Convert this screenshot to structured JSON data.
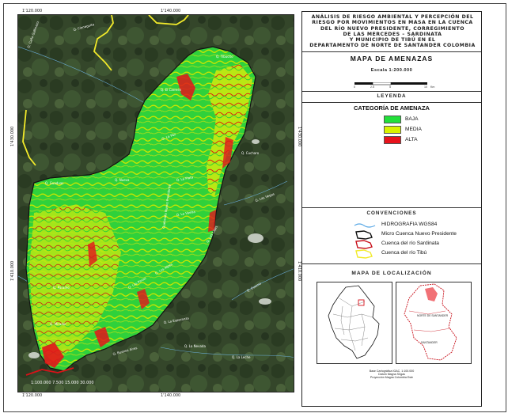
{
  "title_lines": [
    "ANÁLISIS DE RIESGO AMBIENTAL Y PERCEPCIÓN DEL",
    "RIESGO POR MOVIMIENTOS EN MASA EN LA CUENCA",
    "DEL RÍO NUEVO PRESIDENTE, CORREGIMIENTO",
    "DE LAS MERCEDES – SARDINATA",
    "Y MUNICIPIO DE TIBÚ EN EL",
    "DEPARTAMENTO DE NORTE DE SANTANDER COLOMBIA"
  ],
  "map_title": "MAPA DE AMENAZAS",
  "scale": "Escala 1:200.000",
  "scale_ticks": [
    "0",
    "2.5",
    "5",
    "10",
    "Km"
  ],
  "legend_title": "LEYENDA",
  "category_title": "CATEGORÍA DE AMENAZA",
  "categories": [
    {
      "label": "BAJA",
      "color": "#22e03a"
    },
    {
      "label": "MEDIA",
      "color": "#d9f200"
    },
    {
      "label": "ALTA",
      "color": "#e8121b"
    }
  ],
  "conventions_title": "CONVENCIONES",
  "conventions": [
    {
      "label": "HIDROGRAFIA WGS84",
      "color": "#5aa9e6"
    },
    {
      "label": "Micro Cuenca Nuevo Presidente",
      "color": "#111111"
    },
    {
      "label": "Cuenca del río Sardinata",
      "color": "#c8101a"
    },
    {
      "label": "Cuenca del río Tibú",
      "color": "#f2ea2a"
    }
  ],
  "location_title": "MAPA DE LOCALIZACIÓN",
  "location_label_a": "NORTE DE SANTANDER",
  "location_label_b": "SANTANDER",
  "credits": [
    "Base Cartográfica IGAC, 1:100.000",
    "Datum Magna Sirgas",
    "Proyección Magna Colombia Este"
  ],
  "coords": {
    "top_left": "1'120.000",
    "top_mid": "1'140.000",
    "bottom_left": "1'120.000",
    "bottom_mid": "1'140.000",
    "left_upper": "1'430.000",
    "left_lower": "1'410.000",
    "right_upper": "1'430.000",
    "right_lower": "1'410.000"
  },
  "map_labels": [
    "Q. Caño Gallinazo",
    "Q. Cienaguita",
    "Q. El Carmen",
    "Q. Tibucito",
    "Q. Guaduas",
    "Q. Nueva",
    "Q. La Plata",
    "Q. Los Alpes",
    "Q. Las Vegas",
    "Q. La Vuelta",
    "Q. Paramo",
    "Q. Las Pavas",
    "Q. La Esperanza",
    "Q. Guamo",
    "Q. La Nevada",
    "Q. La Leche",
    "Q. Cucharo",
    "Q. La Paz",
    "Quebrada Nuevo Presidente",
    "Q. Las Lajas",
    "Q. Mirador",
    "Q. Buenos Aires"
  ],
  "map_scale_text": "1:100.000  7.500  15.000   30.000"
}
